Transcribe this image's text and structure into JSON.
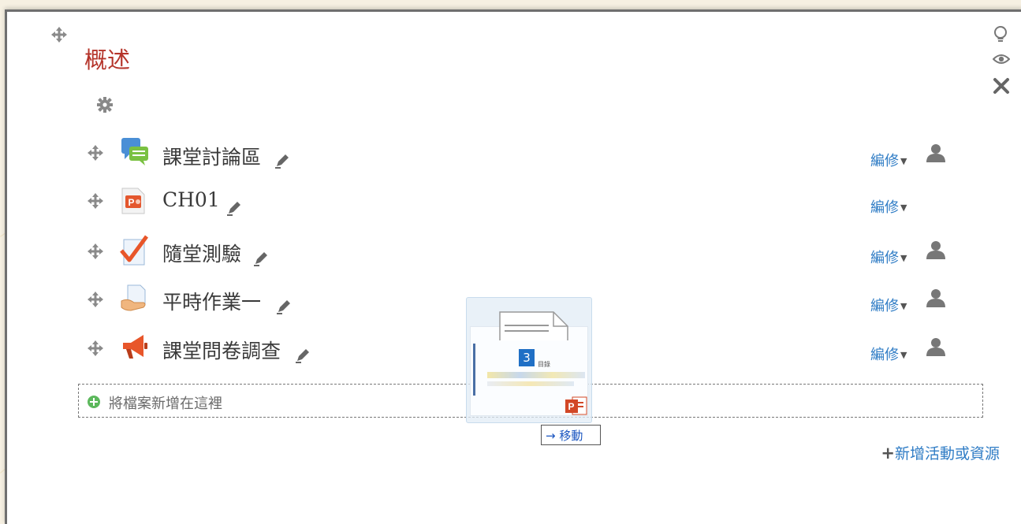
{
  "section": {
    "title": "概述"
  },
  "activities": [
    {
      "name": "課堂討論區",
      "icon": "forum-icon",
      "edit_label": "編修",
      "has_user_icon": true
    },
    {
      "name": "CH01",
      "icon": "powerpoint-icon",
      "edit_label": "編修",
      "has_user_icon": false
    },
    {
      "name": "隨堂測驗",
      "icon": "quiz-icon",
      "edit_label": "編修",
      "has_user_icon": true
    },
    {
      "name": "平時作業一",
      "icon": "assignment-icon",
      "edit_label": "編修",
      "has_user_icon": true
    },
    {
      "name": "課堂問卷調查",
      "icon": "feedback-icon",
      "edit_label": "編修",
      "has_user_icon": true
    }
  ],
  "dropzone": {
    "label": "將檔案新增在這裡"
  },
  "add_activity": {
    "label": "新增活動或資源"
  },
  "drag": {
    "tooltip": "→ 移動",
    "slide_number": "3",
    "slide_caption": "目錄"
  },
  "colors": {
    "title": "#b5342a",
    "link": "#2f7cc5",
    "icon_gray": "#7a7a7a"
  }
}
